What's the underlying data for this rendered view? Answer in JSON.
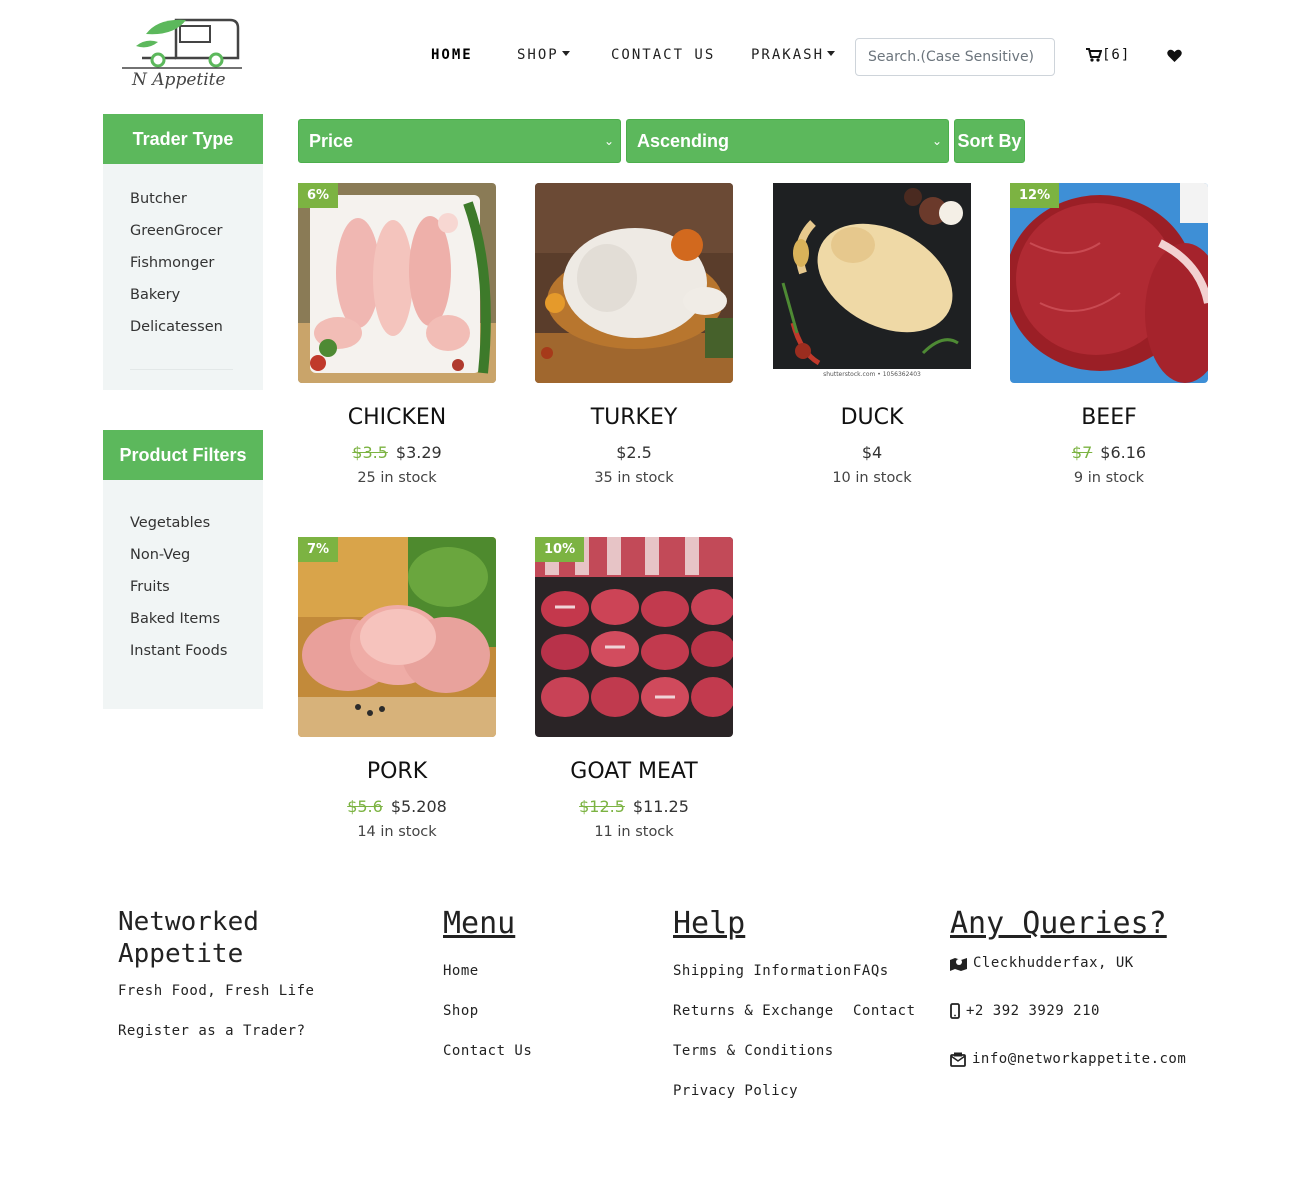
{
  "brand": {
    "logo_text": "N Appetite"
  },
  "nav": {
    "home": "HOME",
    "shop": "SHOP",
    "contact": "CONTACT US",
    "user": "PRAKASH",
    "search_placeholder": "Search.(Case Sensitive)",
    "cart_count": "[6]"
  },
  "sidebar": {
    "trader_title": "Trader Type",
    "trader_items": [
      "Butcher",
      "GreenGrocer",
      "Fishmonger",
      "Bakery",
      "Delicatessen"
    ],
    "filter_title": "Product Filters",
    "filter_items": [
      "Vegetables",
      "Non-Veg",
      "Fruits",
      "Baked Items",
      "Instant Foods"
    ]
  },
  "sort": {
    "field": "Price",
    "order": "Ascending",
    "button": "Sort By"
  },
  "products": [
    {
      "name": "CHICKEN",
      "badge": "6%",
      "old_price": "$3.5",
      "price": "$3.29",
      "stock": "25 in stock"
    },
    {
      "name": "TURKEY",
      "badge": "",
      "old_price": "",
      "price": "$2.5",
      "stock": "35 in stock"
    },
    {
      "name": "DUCK",
      "badge": "",
      "old_price": "",
      "price": "$4",
      "stock": "10 in stock"
    },
    {
      "name": "BEEF",
      "badge": "12%",
      "old_price": "$7",
      "price": "$6.16",
      "stock": "9 in stock"
    },
    {
      "name": "PORK",
      "badge": "7%",
      "old_price": "$5.6",
      "price": "$5.208",
      "stock": "14 in stock"
    },
    {
      "name": "GOAT MEAT",
      "badge": "10%",
      "old_price": "$12.5",
      "price": "$11.25",
      "stock": "11 in stock"
    }
  ],
  "duck_watermark": "shutterstock.com • 1056362403",
  "footer": {
    "brand_line1": "Networked",
    "brand_line2": "Appetite",
    "tagline": "Fresh Food, Fresh Life",
    "register": "Register as a Trader?",
    "menu_title": "Menu",
    "menu_items": [
      "Home",
      "Shop",
      "Contact Us"
    ],
    "help_title": "Help",
    "help_items": [
      "Shipping Information",
      "Returns & Exchange",
      "Terms & Conditions",
      "Privacy Policy"
    ],
    "help_items2": [
      "FAQs",
      "Contact"
    ],
    "queries_title": "Any Queries?",
    "address": "Cleckhudderfax, UK",
    "phone": "+2 392 3929 210",
    "email": "info@networkappetite.com"
  },
  "colors": {
    "accent": "#5cb85c",
    "badge": "#7cb342",
    "sidebar_bg": "#f1f5f5"
  }
}
